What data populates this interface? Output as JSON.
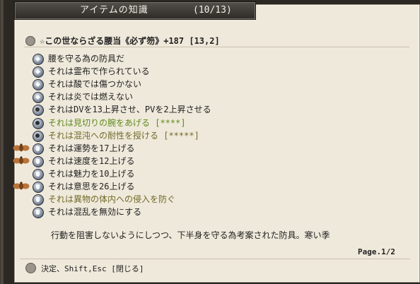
{
  "window": {
    "title": "アイテムの知識",
    "counter": "(10/13)"
  },
  "item": {
    "header": "☆この世ならざる腰当《必ず笏》+187  [13,2]"
  },
  "attributes": [
    {
      "text": "腰を守る為の防具だ",
      "color": "normal",
      "icon": "diamond-icon"
    },
    {
      "text": "それは霊布で作られている",
      "color": "normal",
      "icon": "diamond-icon"
    },
    {
      "text": "それは酸では傷つかない",
      "color": "normal",
      "icon": "diamond-icon"
    },
    {
      "text": "それは炎では燃えない",
      "color": "normal",
      "icon": "diamond-icon"
    },
    {
      "text": "それはDVを13上昇させ、PVを2上昇させる",
      "color": "normal",
      "icon": "gear-icon"
    },
    {
      "text": "それは見切りの腕をあげる [****]",
      "color": "green",
      "icon": "swirl-icon"
    },
    {
      "text": "それは混沌への耐性を授ける [*****]",
      "color": "olive",
      "icon": "swirl-icon"
    },
    {
      "text": "それは運勢を17上げる",
      "color": "normal",
      "icon": "hand-icon",
      "marker": true
    },
    {
      "text": "それは速度を12上げる",
      "color": "normal",
      "icon": "hand-icon",
      "marker": true
    },
    {
      "text": "それは魅力を10上げる",
      "color": "normal",
      "icon": "hand-icon",
      "marker": false
    },
    {
      "text": "それは意思を26上げる",
      "color": "normal",
      "icon": "hand-icon",
      "marker": true
    },
    {
      "text": "それは異物の体内への侵入を防ぐ",
      "color": "olive",
      "icon": "hand-icon",
      "marker": false
    },
    {
      "text": "それは混乱を無効にする",
      "color": "normal",
      "icon": "hand-icon",
      "marker": false
    }
  ],
  "description": "行動を阻害しないようにしつつ、下半身を守る為考案された防具。寒い季",
  "pagination": "Page.1/2",
  "footer": "決定、Shift,Esc [閉じる]"
}
